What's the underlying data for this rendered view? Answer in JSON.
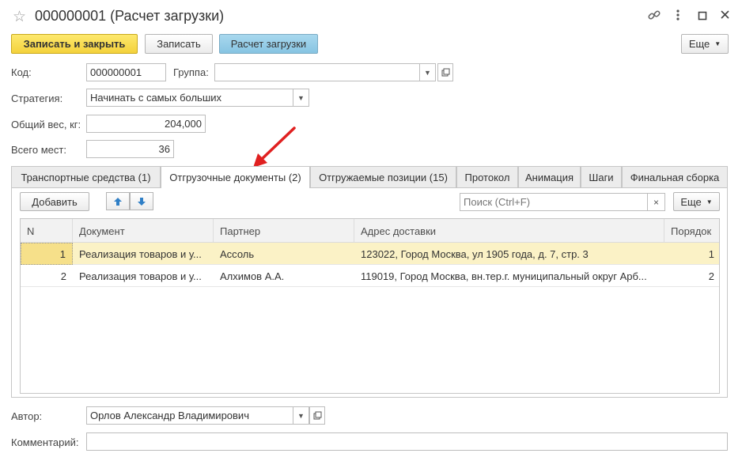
{
  "window": {
    "title": "000000001 (Расчет загрузки)",
    "icons": [
      "star-icon",
      "link-icon",
      "more-vert-icon",
      "maximize-icon",
      "close-icon"
    ]
  },
  "toolbar": {
    "save_close": "Записать и закрыть",
    "save": "Записать",
    "calc": "Расчет загрузки",
    "more": "Еще"
  },
  "form": {
    "code_label": "Код:",
    "code_value": "000000001",
    "group_label": "Группа:",
    "group_value": "",
    "strategy_label": "Стратегия:",
    "strategy_value": "Начинать с самых больших",
    "weight_label": "Общий вес, кг:",
    "weight_value": "204,000",
    "places_label": "Всего мест:",
    "places_value": "36",
    "author_label": "Автор:",
    "author_value": "Орлов Александр Владимирович",
    "comment_label": "Комментарий:",
    "comment_value": ""
  },
  "tabs": [
    {
      "label": "Транспортные средства (1)"
    },
    {
      "label": "Отгрузочные документы (2)",
      "active": true
    },
    {
      "label": "Отгружаемые позиции (15)"
    },
    {
      "label": "Протокол"
    },
    {
      "label": "Анимация"
    },
    {
      "label": "Шаги"
    },
    {
      "label": "Финальная сборка"
    }
  ],
  "table_toolbar": {
    "add": "Добавить",
    "search_placeholder": "Поиск (Ctrl+F)",
    "clear": "×",
    "more": "Еще"
  },
  "table": {
    "columns": [
      "N",
      "Документ",
      "Партнер",
      "Адрес доставки",
      "Порядок"
    ],
    "rows": [
      {
        "n": "1",
        "doc": "Реализация товаров и у...",
        "partner": "Ассоль",
        "address": "123022, Город Москва, ул 1905 года, д. 7, стр. 3",
        "order": "1"
      },
      {
        "n": "2",
        "doc": "Реализация товаров и у...",
        "partner": "Алхимов А.А.",
        "address": "119019, Город Москва, вн.тер.г. муниципальный округ Арб...",
        "order": "2"
      }
    ]
  },
  "colors": {
    "annotation_arrow": "#e02020",
    "accent_yellow": "#f4d23c",
    "accent_blue": "#87c4e2",
    "selected_row": "#fbf2c6"
  }
}
